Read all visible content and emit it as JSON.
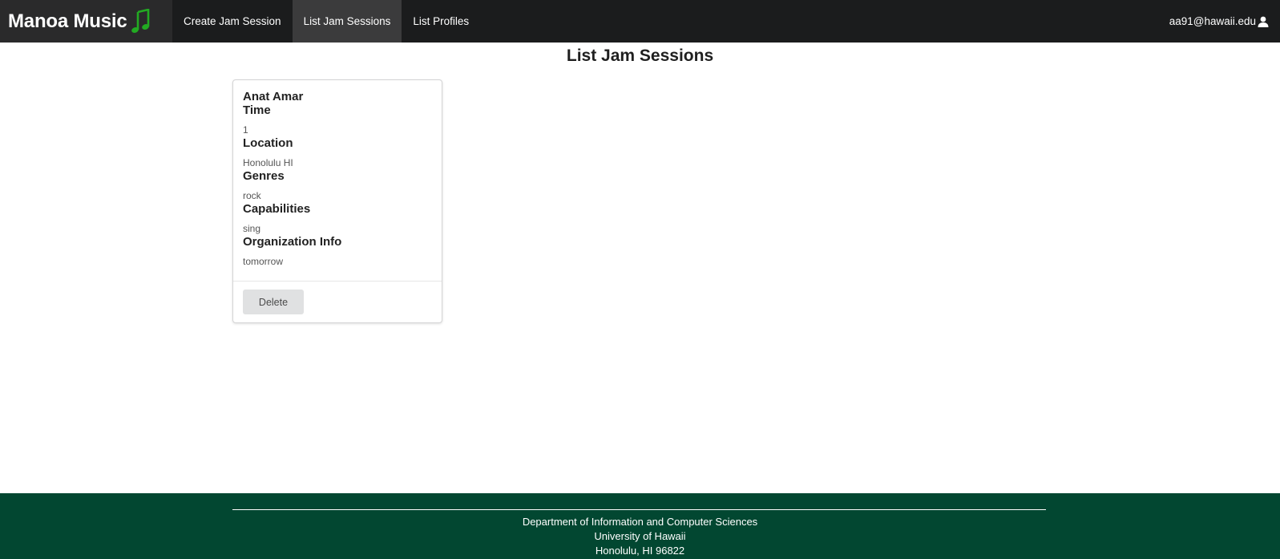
{
  "navbar": {
    "brand": "Manoa Music",
    "brand_icon": "music-note-icon",
    "brand_icon_color": "#22aa22",
    "links": [
      {
        "label": "Create Jam Session",
        "active": false
      },
      {
        "label": "List Jam Sessions",
        "active": true
      },
      {
        "label": "List Profiles",
        "active": false
      }
    ],
    "user_email": "aa91@hawaii.edu",
    "user_icon": "user-icon"
  },
  "page": {
    "title": "List Jam Sessions"
  },
  "session_card": {
    "header": "Anat Amar",
    "time_label": "Time",
    "time_value": "1",
    "location_label": "Location",
    "location_value": "Honolulu HI",
    "genres_label": "Genres",
    "genres_value": "rock",
    "capabilities_label": "Capabilities",
    "capabilities_value": "sing",
    "org_label": "Organization Info",
    "org_value": "tomorrow",
    "delete_label": "Delete"
  },
  "footer": {
    "line1": "Department of Information and Computer Sciences",
    "line2": "University of Hawaii",
    "line3": "Honolulu, HI 96822",
    "background": "#024731"
  }
}
